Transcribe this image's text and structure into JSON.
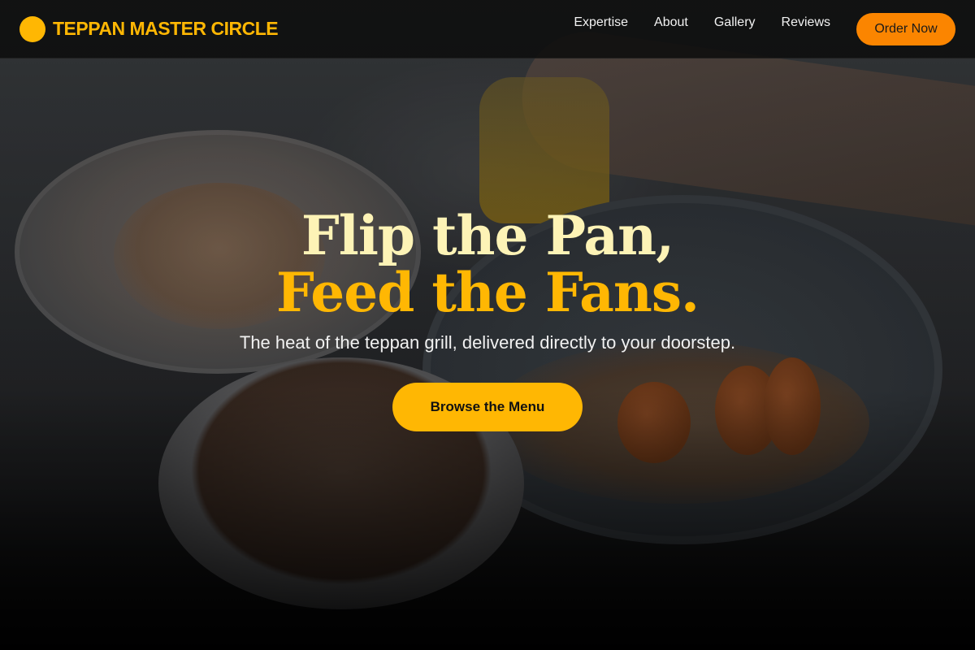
{
  "header": {
    "brand_name": "TEPPAN MASTER CIRCLE",
    "nav": [
      {
        "label": "Expertise"
      },
      {
        "label": "About"
      },
      {
        "label": "Gallery"
      },
      {
        "label": "Reviews"
      }
    ],
    "order_label": "Order Now"
  },
  "hero": {
    "headline_line1": "Flip the Pan,",
    "headline_line2": "Feed the Fans.",
    "subtitle": "The heat of the teppan grill, delivered directly to your doorstep.",
    "cta_label": "Browse the Menu"
  },
  "colors": {
    "brand_yellow": "#ffb703",
    "order_orange": "#fb8500",
    "headline_cream": "#fdf3b6",
    "nav_bg": "#0e0e0e"
  },
  "icons": {
    "logo": "logo-circle-icon"
  }
}
